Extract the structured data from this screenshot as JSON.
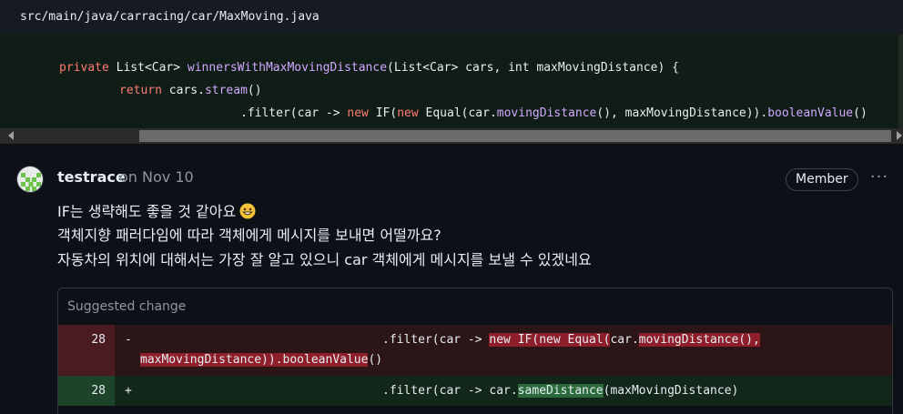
{
  "file": {
    "path": "src/main/java/carracing/car/MaxMoving.java"
  },
  "code": {
    "line1": {
      "kw_private": "private",
      "type_ret": " List<Car> ",
      "method": "winnersWithMaxMovingDistance",
      "params": "(List<Car> cars, int maxMovingDistance) {"
    },
    "line2": {
      "kw_return": "return",
      "rest1": " cars.",
      "stream": "stream",
      "rest2": "()"
    },
    "line3": {
      "p1": ".filter(car -> ",
      "new1": "new",
      "p2": " IF(",
      "new2": "new",
      "p3": " Equal(car.",
      "movingDistance": "movingDistance",
      "p4": "(), maxMovingDistance)).",
      "booleanValue": "booleanValue",
      "p5": "()"
    }
  },
  "comment": {
    "author": "testrace",
    "date": "on Nov 10",
    "badge": "Member",
    "more": "···",
    "lines": [
      "IF는 생략해도 좋을 것 같아요",
      "객체지향 패러다임에 따라 객체에게 메시지를 보내면 어떨까요?",
      "자동차의 위치에 대해서는 가장 잘 알고 있으니 car 객체에게 메시지를 보낼 수 있겠네요"
    ],
    "emoji": "grinning-face-emoji"
  },
  "suggestion": {
    "title": "Suggested change",
    "del": {
      "lineno": "28",
      "sign": "-",
      "pre": ".filter(car -> ",
      "hl1": "new IF(new Equal(",
      "mid": "car.",
      "hl2": "movingDistance(),",
      "wrap_hl": "maxMovingDistance)).booleanValue",
      "wrap_rest": "()"
    },
    "add": {
      "lineno": "28",
      "sign": "+",
      "pre": ".filter(car -> car.",
      "hl": "sameDistance",
      "post": "(maxMovingDistance)"
    }
  },
  "colors": {
    "background": "#0d1117",
    "keyword": "#ff7b72",
    "function": "#d2a8ff",
    "diff_del": "#4a1c21",
    "diff_add": "#1d4428"
  }
}
